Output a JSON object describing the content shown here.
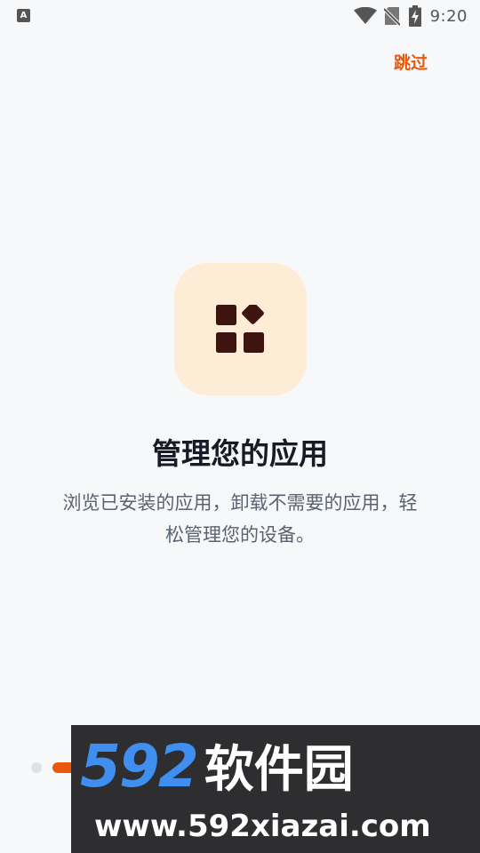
{
  "status_bar": {
    "left_icon": "A",
    "icons": [
      "wifi-icon",
      "no-sim-icon",
      "battery-charging-icon"
    ],
    "time": "9:20"
  },
  "header": {
    "skip_label": "跳过"
  },
  "onboarding": {
    "icon": "apps-grid-icon",
    "title": "管理您的应用",
    "description": "浏览已安装的应用，卸载不需要的应用，轻松管理您的设备。"
  },
  "pager": {
    "total_visible": 2,
    "active_index": 1
  },
  "watermark": {
    "brand_digits": "592",
    "brand_name": "软件园",
    "url": "www.592xiazai.com"
  },
  "colors": {
    "background": "#f7f8fa",
    "accent": "#e8590c",
    "icon_tile": "#fdecd6",
    "icon_glyph": "#3d1410",
    "title": "#161b26",
    "description": "#5a6272"
  }
}
